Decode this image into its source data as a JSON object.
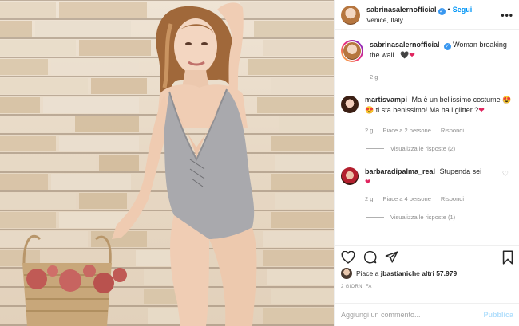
{
  "post": {
    "username": "sabrinasalernofficial",
    "follow_label": "Segui",
    "location": "Venice, Italy",
    "separator": "•",
    "more_label": "•••"
  },
  "caption": {
    "username": "sabrinasalernofficial",
    "text": "Woman breaking the wall...",
    "time": "2 g"
  },
  "comments": [
    {
      "username": "martisvampi",
      "text": "Ma è un bellissimo costume 😍😍 ti sta benissimo! Ma ha i glitter ?",
      "time": "2 g",
      "likes": "Piace a 2 persone",
      "reply_label": "Rispondi",
      "view_replies": "Visualizza le risposte (2)"
    },
    {
      "username": "barbaradipalma_real",
      "text": "Stupenda sei",
      "time": "2 g",
      "likes": "Piace a 4 persone",
      "reply_label": "Rispondi",
      "view_replies": "Visualizza le risposte (1)"
    }
  ],
  "likes_line": {
    "prefix": "Piace a ",
    "user": "jbastianich",
    "middle": " e ",
    "others": "altri 57.979"
  },
  "date": "2 GIORNI FA",
  "add_comment": {
    "placeholder": "Aggiungi un commento...",
    "publish_label": "Pubblica"
  },
  "colors": {
    "link_blue": "#0095f6",
    "publish_disabled": "#b2dffc",
    "heart_red": "#e0245e",
    "muted": "#8e8e8e"
  },
  "icons": [
    "heart-icon",
    "comment-icon",
    "share-icon",
    "bookmark-icon",
    "verified-badge-icon",
    "more-icon",
    "like-comment-icon"
  ]
}
